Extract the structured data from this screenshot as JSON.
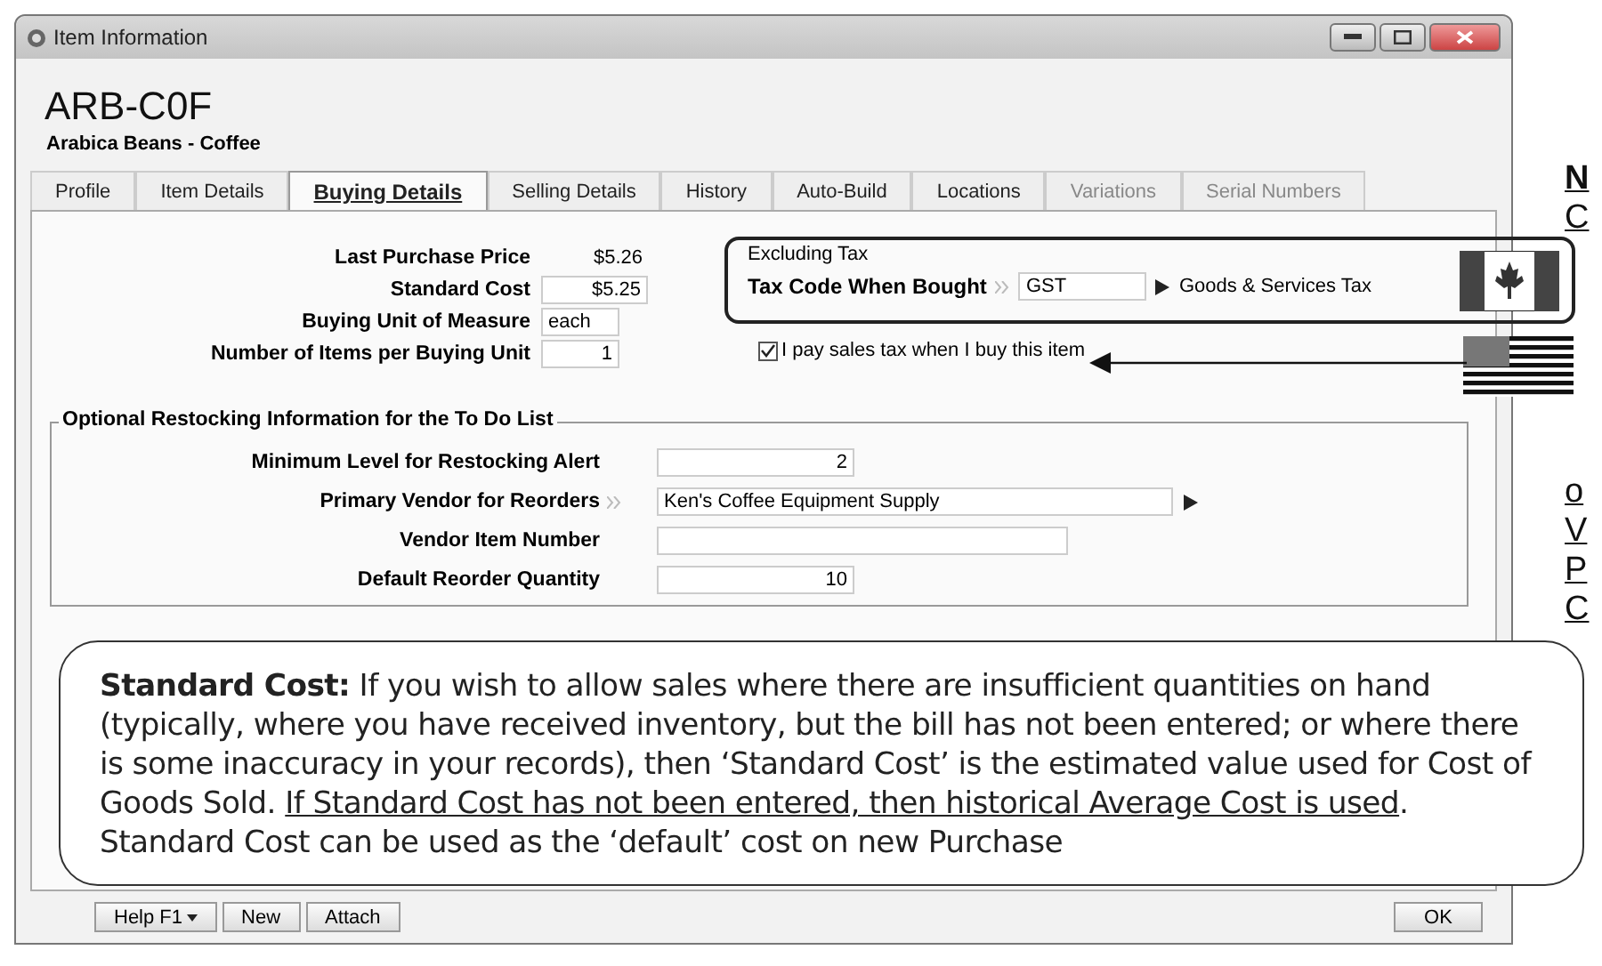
{
  "window": {
    "title": "Item Information"
  },
  "item": {
    "code": "ARB-C0F",
    "name": "Arabica Beans - Coffee"
  },
  "tabs": [
    {
      "label": "Profile",
      "selected": false,
      "disabled": false
    },
    {
      "label": "Item Details",
      "selected": false,
      "disabled": false
    },
    {
      "label": "Buying Details",
      "selected": true,
      "disabled": false
    },
    {
      "label": "Selling Details",
      "selected": false,
      "disabled": false
    },
    {
      "label": "History",
      "selected": false,
      "disabled": false
    },
    {
      "label": "Auto-Build",
      "selected": false,
      "disabled": false
    },
    {
      "label": "Locations",
      "selected": false,
      "disabled": false
    },
    {
      "label": "Variations",
      "selected": false,
      "disabled": true
    },
    {
      "label": "Serial Numbers",
      "selected": false,
      "disabled": true
    }
  ],
  "buying_fields": [
    {
      "label": "Last Purchase Price",
      "value": "$5.26",
      "kind": "text"
    },
    {
      "label": "Standard Cost",
      "value": "$5.25",
      "kind": "wide"
    },
    {
      "label": "Buying Unit of Measure",
      "value": "each",
      "kind": "unit"
    },
    {
      "label": "Number of Items per Buying Unit",
      "value": "1",
      "kind": "count"
    }
  ],
  "tax": {
    "note": "Excluding Tax",
    "label": "Tax Code When Bought",
    "code": "GST",
    "description": "Goods & Services Tax"
  },
  "pay_sales_tax": {
    "label": "I pay sales tax when I buy this item",
    "checked": true
  },
  "restocking": {
    "title": "Optional Restocking Information for the To Do List",
    "fields": [
      {
        "label": "Minimum Level for Restocking Alert",
        "value": "2",
        "kind": "number"
      },
      {
        "label": "Primary Vendor for Reorders",
        "value": "Ken's Coffee Equipment Supply",
        "kind": "lookup"
      },
      {
        "label": "Vendor Item Number",
        "kind": "text"
      },
      {
        "label": "Default Reorder Quantity",
        "value": "10",
        "kind": "number"
      }
    ]
  },
  "buttons": [
    {
      "label": "Help F1",
      "kind": "menu"
    },
    {
      "label": "New",
      "kind": "plain"
    },
    {
      "label": "Attach",
      "kind": "plain"
    }
  ],
  "ok_button": "OK",
  "callout": [
    {
      "text": "**Standard Cost:** If you wish to allow sales where there are insufficient quantities on hand (typically, where you have received inventory, but the bill has not been entered; or where there is some inaccuracy in your records), then ‘Standard Cost’ is the estimated value used for Cost of Goods Sold. ",
      "underline": false
    },
    {
      "text": "If Standard Cost has not been entered, then historical Average Cost is used",
      "underline": true
    },
    {
      "text": ". Standard Cost can be used as the ‘default’ cost on new Purchase",
      "underline": false
    }
  ],
  "margin_text": [
    {
      "text": "N",
      "bold": true
    },
    {
      "text": "C",
      "bold": false
    },
    {
      "text": "o",
      "bold": false
    },
    {
      "text": "V",
      "bold": false
    },
    {
      "text": "P",
      "bold": false
    },
    {
      "text": "C",
      "bold": false
    }
  ]
}
